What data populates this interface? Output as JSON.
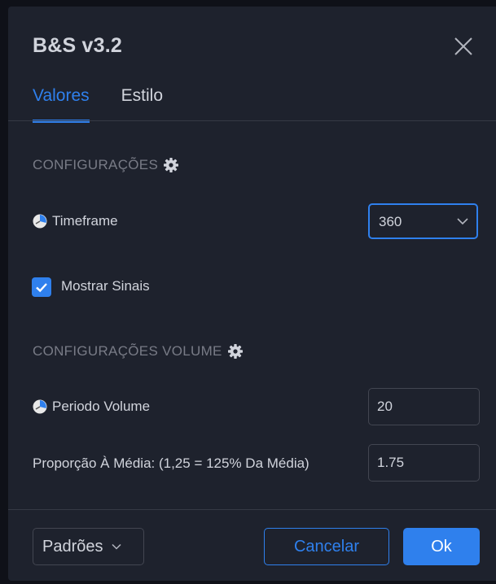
{
  "dialog": {
    "title": "B&S v3.2",
    "close_icon": "close-icon"
  },
  "tabs": [
    {
      "label": "Valores",
      "active": true
    },
    {
      "label": "Estilo",
      "active": false
    }
  ],
  "settings": {
    "section_main": "CONFIGURAÇÕES",
    "timeframe_label": "Timeframe",
    "timeframe_value": "360",
    "show_signals_label": "Mostrar Sinais",
    "show_signals_checked": true,
    "section_volume": "CONFIGURAÇÕES VOLUME",
    "volume_period_label": "Periodo Volume",
    "volume_period_value": "20",
    "ratio_label": "Proporção À Média: (1,25 = 125% Da Média)",
    "ratio_value": "1.75"
  },
  "footer": {
    "defaults_label": "Padrões",
    "cancel_label": "Cancelar",
    "ok_label": "Ok"
  },
  "colors": {
    "accent": "#2f80ed",
    "panel": "#1e222d",
    "text": "#d1d4dc",
    "muted": "#787b86"
  }
}
